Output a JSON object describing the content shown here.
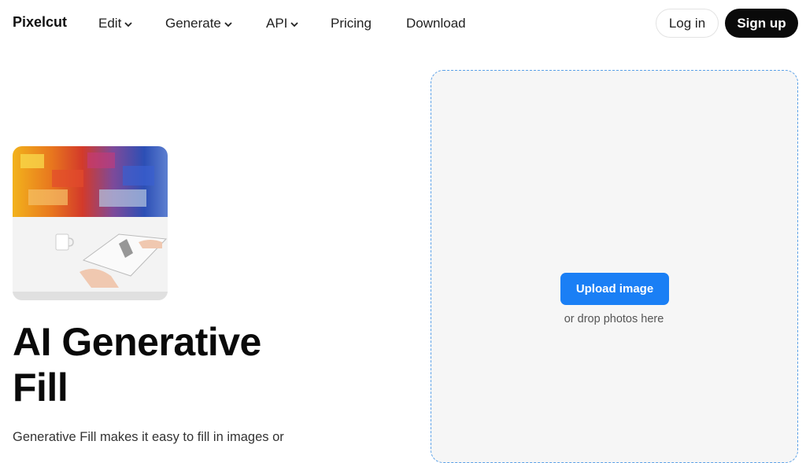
{
  "nav": {
    "brand": "Pixelcut",
    "items": [
      {
        "label": "Edit",
        "dropdown": true
      },
      {
        "label": "Generate",
        "dropdown": true
      },
      {
        "label": "API",
        "dropdown": true
      },
      {
        "label": "Pricing",
        "dropdown": false
      },
      {
        "label": "Download",
        "dropdown": false
      }
    ],
    "login_label": "Log in",
    "signup_label": "Sign up"
  },
  "hero": {
    "title_line1": "AI Generative",
    "title_line2": "Fill",
    "description": "Generative Fill makes it easy to fill in images or"
  },
  "upload": {
    "button_label": "Upload image",
    "hint": "or drop photos here"
  },
  "colors": {
    "accent": "#1a7ff5",
    "dropzone_border": "#5aa0e8",
    "signup_bg": "#0a0a0a"
  }
}
